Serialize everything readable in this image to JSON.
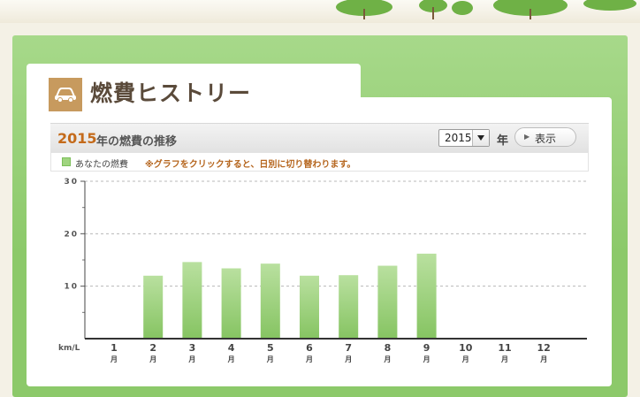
{
  "header": {
    "title": "燃費ヒストリー",
    "icon": "car-icon"
  },
  "subheader": {
    "year": "2015",
    "text": "年の燃費の推移",
    "select_value": "2015",
    "year_unit": "年",
    "show_button": "表示"
  },
  "legend": {
    "label": "あなたの燃費",
    "note": "※グラフをクリックすると、日別に切り替わります。",
    "swatch_color": "#9fd47f"
  },
  "chart_data": {
    "type": "bar",
    "categories": [
      "1",
      "2",
      "3",
      "4",
      "5",
      "6",
      "7",
      "8",
      "9",
      "10",
      "11",
      "12"
    ],
    "category_suffix": "月",
    "values": [
      null,
      12.0,
      14.6,
      13.4,
      14.3,
      12.0,
      12.1,
      13.9,
      16.2,
      null,
      null,
      null
    ],
    "ylabel": "km/L",
    "ylim": [
      0,
      30
    ],
    "yticks": [
      "30",
      "20",
      "10"
    ],
    "grid": true,
    "bar_color": "#96cf74"
  }
}
